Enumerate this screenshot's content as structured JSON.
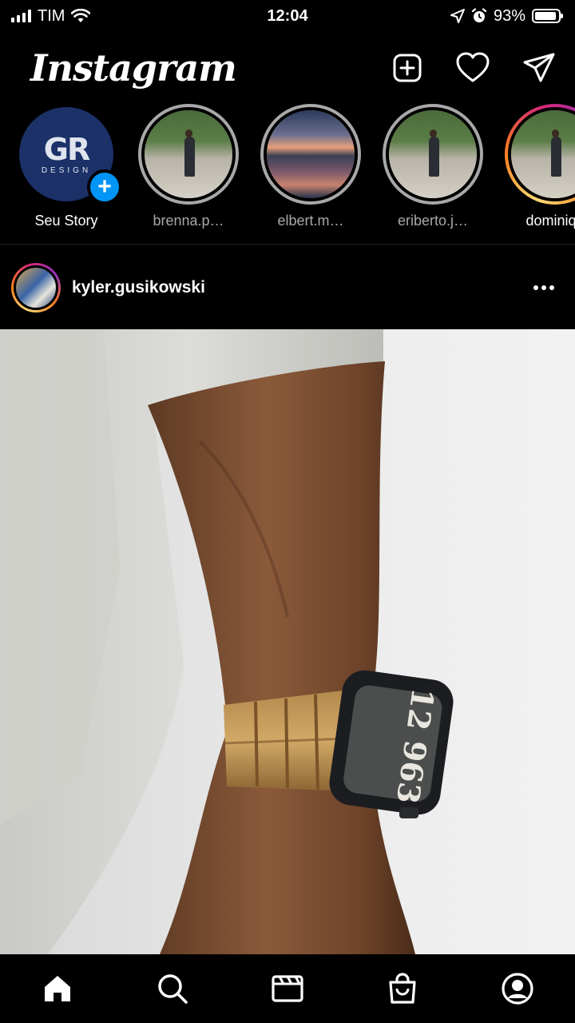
{
  "status_bar": {
    "carrier": "TIM",
    "time": "12:04",
    "battery_percent": "93%",
    "battery_level": 0.93,
    "icons": [
      "signal-icon",
      "wifi-icon",
      "location-arrow-icon",
      "alarm-icon",
      "battery-icon"
    ]
  },
  "header": {
    "logo": "Instagram",
    "actions": [
      "new-post-icon",
      "heart-icon",
      "direct-message-icon"
    ]
  },
  "stories": [
    {
      "label": "Seu Story",
      "own": true,
      "avatar_text": "GR",
      "avatar_sub": "DESIGN",
      "add_symbol": "+"
    },
    {
      "label": "brenna.p…",
      "ring": "seen",
      "image": "bridge"
    },
    {
      "label": "elbert.m…",
      "ring": "seen",
      "image": "sunset"
    },
    {
      "label": "eriberto.j…",
      "ring": "seen",
      "image": "bridge"
    },
    {
      "label": "dominiqu",
      "ring": "new",
      "image": "bridge"
    }
  ],
  "post": {
    "username": "kyler.gusikowski",
    "watch_face_text": "12 963"
  },
  "bottom_nav": [
    "home-icon",
    "search-icon",
    "reels-icon",
    "shop-icon",
    "profile-icon"
  ],
  "colors": {
    "background": "#000000",
    "accent_blue": "#0095f6",
    "seen_ring": "#a8a8a8"
  }
}
